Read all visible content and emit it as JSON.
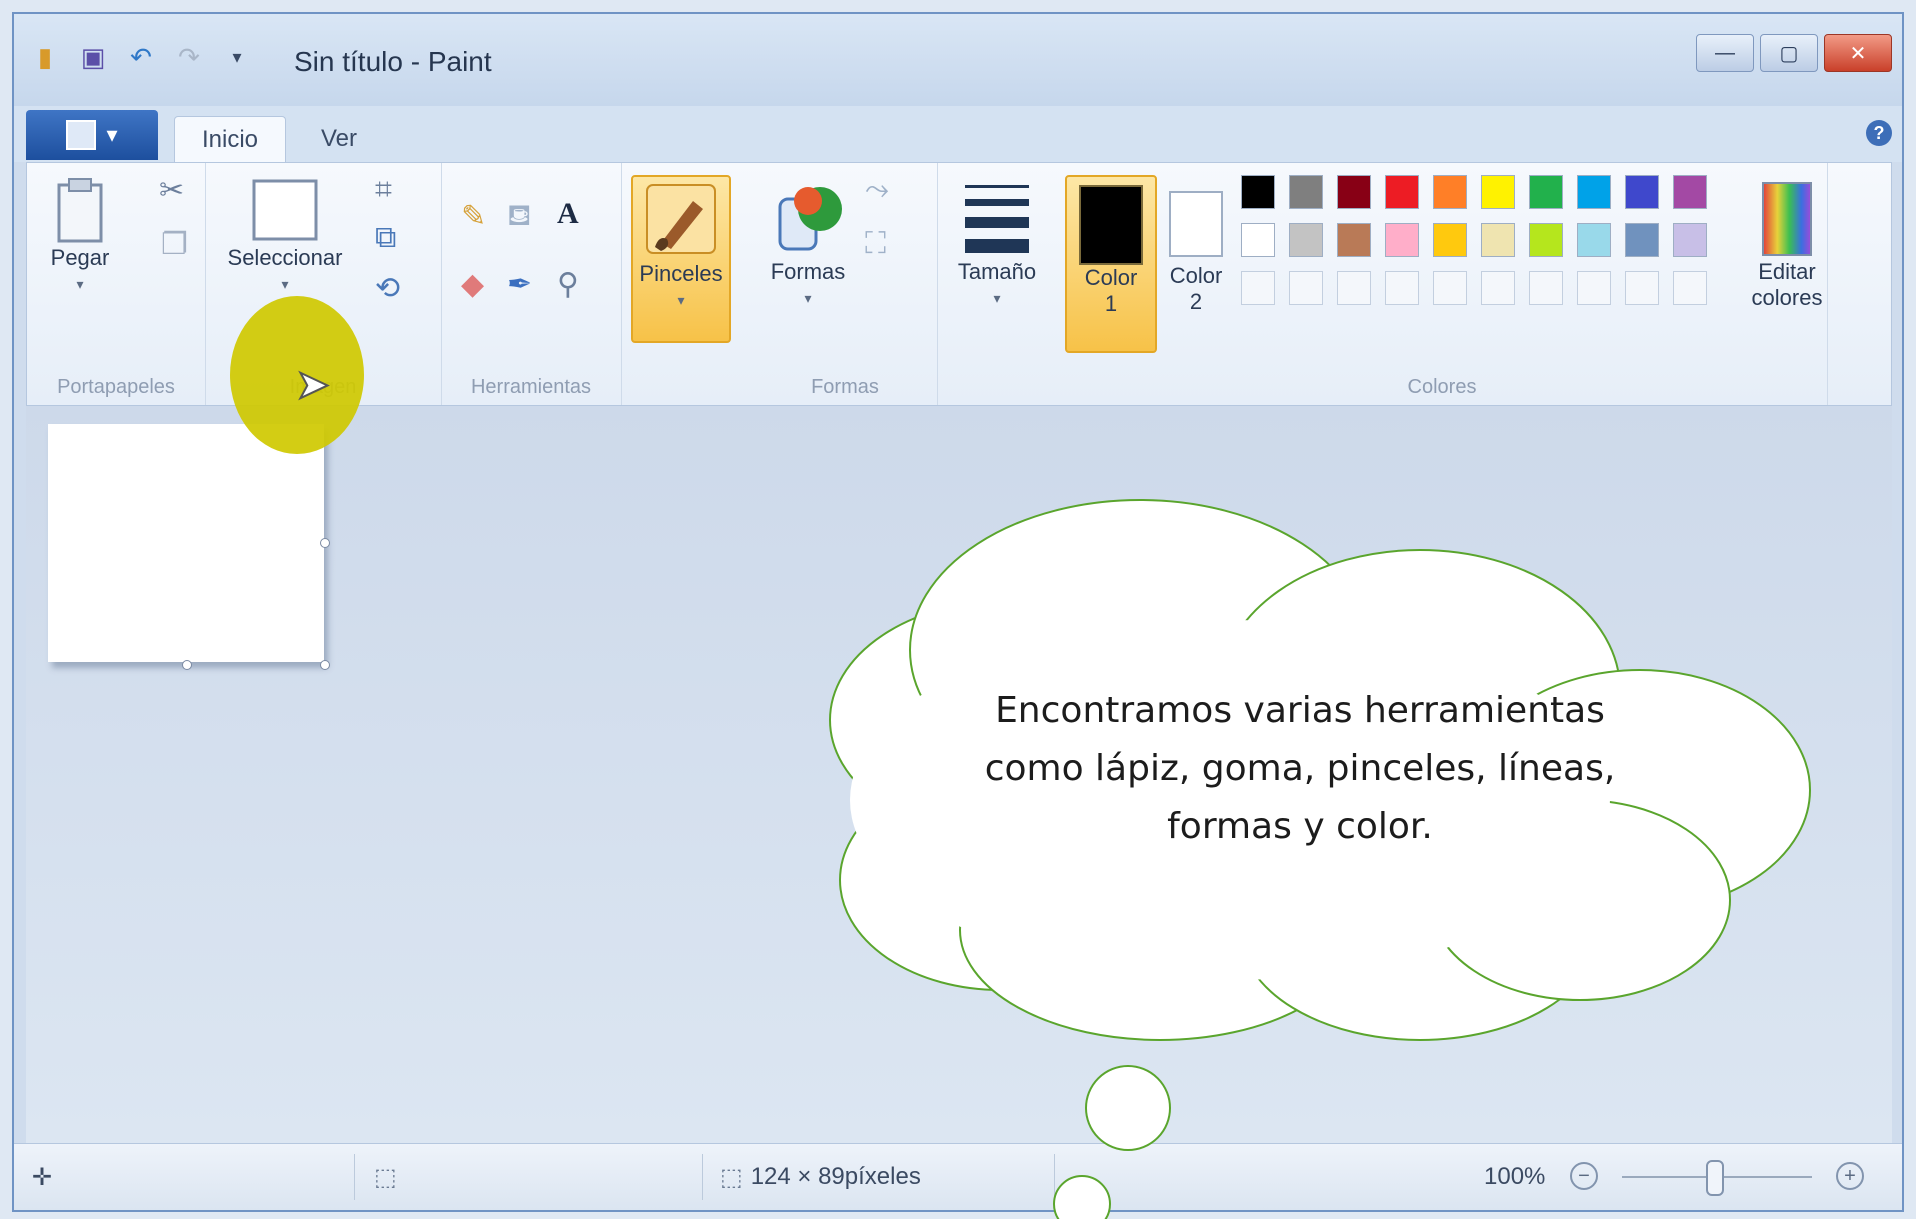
{
  "window": {
    "title": "Sin título - Paint",
    "close_glyph": "✕",
    "minimize_glyph": "—",
    "maximize_glyph": "▢"
  },
  "tabs": {
    "active": "Inicio",
    "second": "Ver",
    "help": "?"
  },
  "ribbon": {
    "clipboard": {
      "paste": "Pegar",
      "label": "Portapapeles"
    },
    "image": {
      "select": "Seleccionar",
      "label": "Imagen"
    },
    "tools": {
      "label": "Herramientas",
      "text_tool": "A"
    },
    "brushes": {
      "label": "Pinceles"
    },
    "shapes": {
      "shapes": "Formas",
      "label": "Formas"
    },
    "size": {
      "label": "Tamaño"
    },
    "colors": {
      "color1_line1": "Color",
      "color1_line2": "1",
      "color2_line1": "Color",
      "color2_line2": "2",
      "edit_line1": "Editar",
      "edit_line2": "colores",
      "label": "Colores",
      "row1": [
        "#000000",
        "#7f7f7f",
        "#880015",
        "#ed1c24",
        "#ff7f27",
        "#fff200",
        "#22b14c",
        "#00a2e8",
        "#3f48cc",
        "#a349a4"
      ],
      "row2": [
        "#ffffff",
        "#c3c3c3",
        "#b97a57",
        "#ffaec9",
        "#ffc90e",
        "#efe4b0",
        "#b5e61d",
        "#99d9ea",
        "#7092be",
        "#c8bfe7"
      ]
    }
  },
  "status": {
    "move_icon": "move-cursor-icon",
    "dimensions": "124 × 89píxeles",
    "zoom": "100%",
    "zoom_out": "−",
    "zoom_in": "+"
  },
  "callout": {
    "text": "Encontramos varias herramientas como lápiz, goma, pinceles, líneas, formas y color.",
    "fill": "#ffffff",
    "stroke": "#5aa52d"
  },
  "colors": {
    "cursor_highlight": "#cfc900",
    "selected_button": "#f7c248"
  }
}
